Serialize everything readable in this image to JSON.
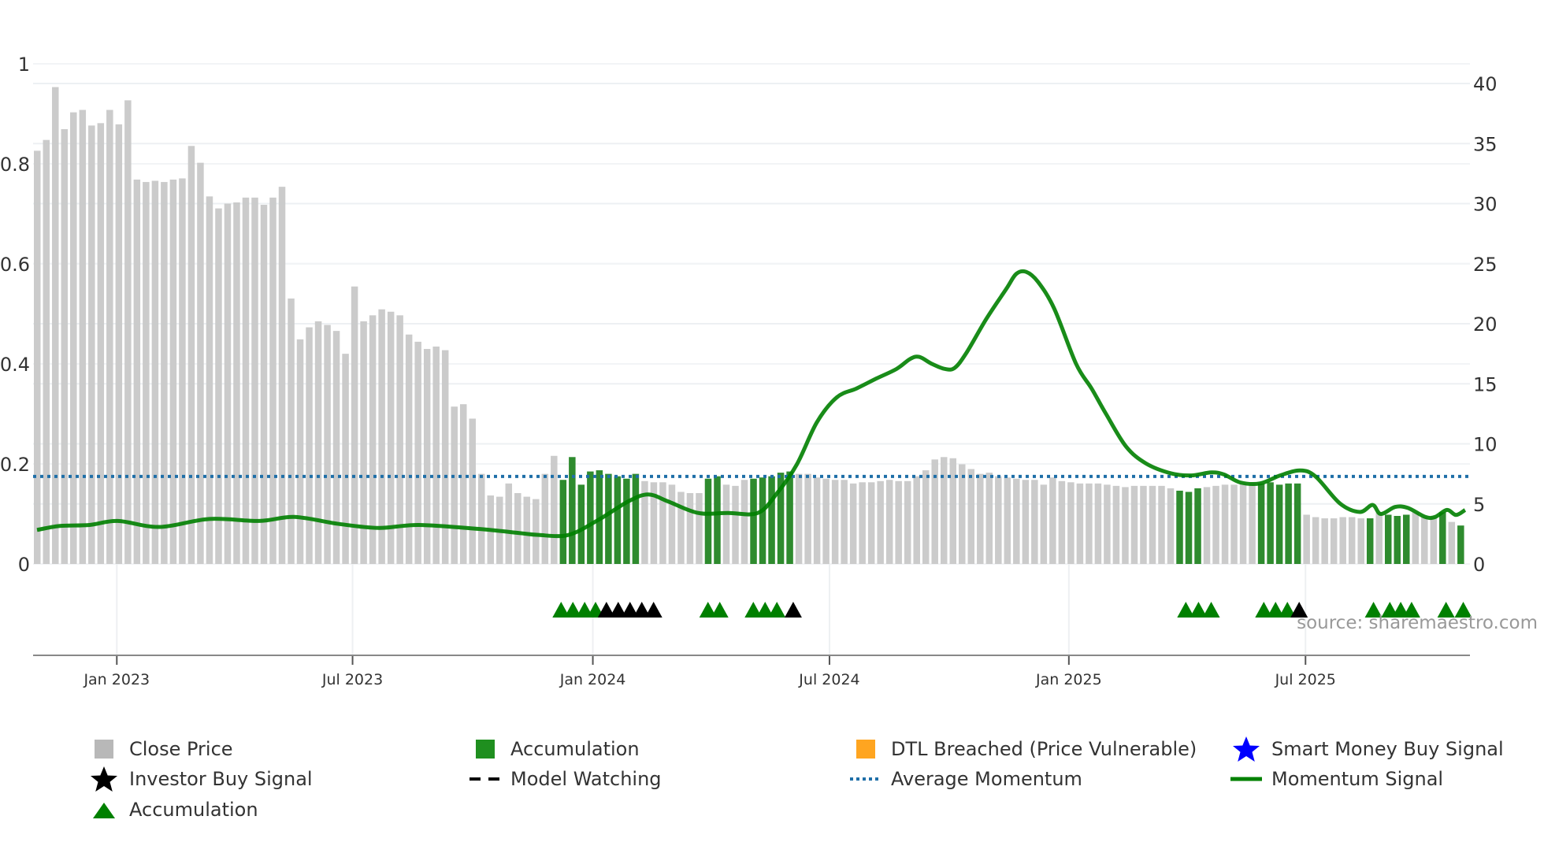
{
  "chart_data": {
    "type": "bar",
    "title": "",
    "x_unit": "week index (weekly bars, Nov 2022 - Oct 2025)",
    "x_ticks": [
      "Jan 2023",
      "Jul 2023",
      "Jan 2024",
      "Jul 2024",
      "Jan 2025",
      "Jul 2025"
    ],
    "x_tick_weeks": [
      8.8,
      34.8,
      61.3,
      87.4,
      113.8,
      139.9
    ],
    "left_axis": {
      "ticks": [
        "0",
        "0.2",
        "0.4",
        "0.6",
        "0.8",
        "1"
      ],
      "range": [
        0,
        1
      ]
    },
    "right_axis": {
      "ticks": [
        "0",
        "5",
        "10",
        "15",
        "20",
        "25",
        "30",
        "35",
        "40"
      ],
      "range": [
        0,
        40
      ]
    },
    "close_price": [
      34.4,
      35.3,
      39.7,
      36.2,
      37.6,
      37.8,
      36.5,
      36.7,
      37.8,
      36.6,
      38.6,
      32.0,
      31.8,
      31.9,
      31.8,
      32.0,
      32.1,
      34.8,
      33.4,
      30.6,
      29.6,
      30.0,
      30.1,
      30.5,
      30.5,
      29.9,
      30.5,
      31.4,
      22.1,
      18.7,
      19.7,
      20.2,
      19.9,
      19.4,
      17.5,
      23.1,
      20.2,
      20.7,
      21.2,
      21.0,
      20.7,
      19.1,
      18.5,
      17.9,
      18.1,
      17.8,
      13.1,
      13.3,
      12.1,
      7.5,
      5.7,
      5.6,
      6.7,
      5.9,
      5.6,
      5.4,
      7.5,
      9.0,
      7.0,
      8.9,
      6.6,
      7.7,
      7.8,
      7.5,
      7.3,
      7.1,
      7.5,
      6.9,
      6.8,
      6.8,
      6.6,
      6.0,
      5.9,
      5.9,
      7.1,
      7.3,
      6.6,
      6.5,
      7.0,
      7.1,
      7.2,
      7.3,
      7.6,
      7.7,
      7.5,
      7.5,
      7.2,
      7.1,
      7.0,
      7.0,
      6.7,
      6.8,
      6.8,
      6.9,
      7.0,
      6.9,
      6.9,
      7.3,
      7.8,
      8.7,
      8.9,
      8.8,
      8.3,
      7.9,
      7.5,
      7.6,
      7.3,
      7.2,
      7.1,
      7.0,
      7.0,
      6.6,
      7.2,
      6.9,
      6.8,
      6.7,
      6.7,
      6.7,
      6.6,
      6.5,
      6.4,
      6.5,
      6.5,
      6.5,
      6.5,
      6.3,
      6.1,
      6.0,
      6.3,
      6.4,
      6.5,
      6.6,
      6.6,
      6.7,
      6.7,
      6.7,
      6.8,
      6.6,
      6.7,
      6.7,
      4.1,
      3.9,
      3.8,
      3.8,
      3.9,
      3.9,
      3.8,
      3.8,
      4.3,
      4.1,
      4.0,
      4.1,
      4.3,
      3.9,
      3.9,
      4.3,
      3.5,
      3.2
    ],
    "accumulation_weeks": [
      58,
      59,
      60,
      61,
      62,
      63,
      64,
      65,
      66,
      74,
      75,
      79,
      80,
      81,
      82,
      83,
      126,
      127,
      128,
      135,
      136,
      137,
      138,
      139,
      147,
      149,
      150,
      151,
      155,
      157
    ],
    "average_momentum": 0.175,
    "momentum_signal": [
      [
        0,
        0.068
      ],
      [
        2.5,
        0.076
      ],
      [
        5.8,
        0.078
      ],
      [
        8.9,
        0.086
      ],
      [
        13.5,
        0.074
      ],
      [
        19,
        0.09
      ],
      [
        24.5,
        0.086
      ],
      [
        28.4,
        0.094
      ],
      [
        33.3,
        0.08
      ],
      [
        37.7,
        0.072
      ],
      [
        42.1,
        0.078
      ],
      [
        48.7,
        0.07
      ],
      [
        53.1,
        0.062
      ],
      [
        55.3,
        0.058
      ],
      [
        58.6,
        0.058
      ],
      [
        61.9,
        0.088
      ],
      [
        65.2,
        0.125
      ],
      [
        67.4,
        0.139
      ],
      [
        69.6,
        0.125
      ],
      [
        72.9,
        0.102
      ],
      [
        76.2,
        0.102
      ],
      [
        79.5,
        0.102
      ],
      [
        81.6,
        0.141
      ],
      [
        83.8,
        0.199
      ],
      [
        86,
        0.283
      ],
      [
        88.2,
        0.333
      ],
      [
        90.4,
        0.351
      ],
      [
        92.6,
        0.371
      ],
      [
        94.8,
        0.39
      ],
      [
        96.3,
        0.41
      ],
      [
        97.3,
        0.414
      ],
      [
        98.7,
        0.4
      ],
      [
        100.1,
        0.39
      ],
      [
        101.2,
        0.392
      ],
      [
        102.5,
        0.422
      ],
      [
        104.7,
        0.49
      ],
      [
        106.9,
        0.55
      ],
      [
        108,
        0.58
      ],
      [
        109.1,
        0.584
      ],
      [
        110.4,
        0.564
      ],
      [
        112.2,
        0.51
      ],
      [
        114.6,
        0.4
      ],
      [
        116.3,
        0.351
      ],
      [
        117.9,
        0.3
      ],
      [
        120.1,
        0.235
      ],
      [
        122.3,
        0.201
      ],
      [
        125.1,
        0.181
      ],
      [
        127.3,
        0.177
      ],
      [
        129.5,
        0.183
      ],
      [
        130.9,
        0.179
      ],
      [
        132.7,
        0.163
      ],
      [
        134.9,
        0.161
      ],
      [
        137.1,
        0.177
      ],
      [
        139.3,
        0.187
      ],
      [
        141,
        0.175
      ],
      [
        143.7,
        0.121
      ],
      [
        145.9,
        0.104
      ],
      [
        147.3,
        0.118
      ],
      [
        148.2,
        0.1
      ],
      [
        149.8,
        0.114
      ],
      [
        151.2,
        0.112
      ],
      [
        153.1,
        0.094
      ],
      [
        154.2,
        0.094
      ],
      [
        155.5,
        0.108
      ],
      [
        156.5,
        0.098
      ],
      [
        157.5,
        0.108
      ]
    ],
    "accumulation_triangles": [
      57.8,
      59.1,
      60.4,
      61.6,
      74,
      75.3,
      79,
      80.3,
      81.6,
      126.7,
      128.1,
      129.5,
      135.3,
      136.6,
      137.9,
      147.4,
      149.2,
      150.4,
      151.6,
      155.4,
      157.3
    ],
    "investor_buy_triangles": [
      62.8,
      64.1,
      65.4,
      66.7,
      68,
      83.4,
      139.2
    ],
    "legend": [
      {
        "label": "Close Price",
        "icon": "gray-square"
      },
      {
        "label": "Accumulation",
        "icon": "green-square"
      },
      {
        "label": "DTL Breached (Price Vulnerable)",
        "icon": "orange-square"
      },
      {
        "label": "Smart Money Buy Signal",
        "icon": "blue-star"
      },
      {
        "label": "Investor Buy Signal",
        "icon": "black-star"
      },
      {
        "label": "Model Watching",
        "icon": "black-dashed-line"
      },
      {
        "label": "Average Momentum",
        "icon": "blue-dotted-line"
      },
      {
        "label": "Momentum Signal",
        "icon": "green-line"
      },
      {
        "label": "Accumulation",
        "icon": "green-triangle"
      }
    ],
    "colors": {
      "close": "#c8c8c8",
      "accumulation": "#2e8b2e",
      "momentum": "#008000",
      "average": "#1f6fa8",
      "dtl": "#ffa520",
      "smart_money": "#0000ff",
      "investor": "#000000"
    }
  },
  "source": "source: sharemaestro.com"
}
